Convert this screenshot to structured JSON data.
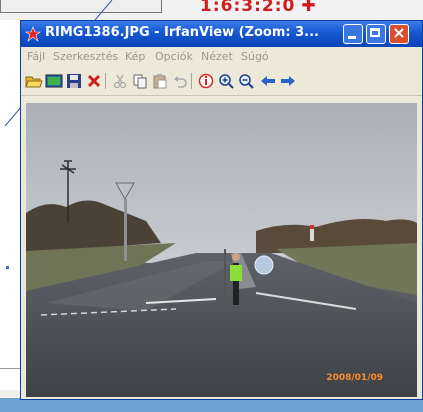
{
  "background": {
    "caption_text": "1:6:3:2:0",
    "caption_color": "#d01c1c"
  },
  "window": {
    "title": "RIMG1386.JPG - IrfanView (Zoom: 3...",
    "titlebar_color": "#1557d0",
    "buttons": {
      "minimize": "minimize",
      "maximize": "maximize",
      "close": "×"
    }
  },
  "menu": {
    "items": [
      "Fájl",
      "Szerkesztés",
      "Kép",
      "Opciók",
      "Nézet",
      "Súgó"
    ]
  },
  "toolbar": {
    "tools": [
      "open-folder-icon",
      "thumbnails-icon",
      "save-icon",
      "delete-icon",
      "cut-icon",
      "copy-icon",
      "paste-icon",
      "undo-icon",
      "info-icon",
      "zoom-in-icon",
      "zoom-out-icon",
      "previous-arrow-icon",
      "next-arrow-icon"
    ]
  },
  "photo": {
    "timestamp": "2008/01/09"
  }
}
